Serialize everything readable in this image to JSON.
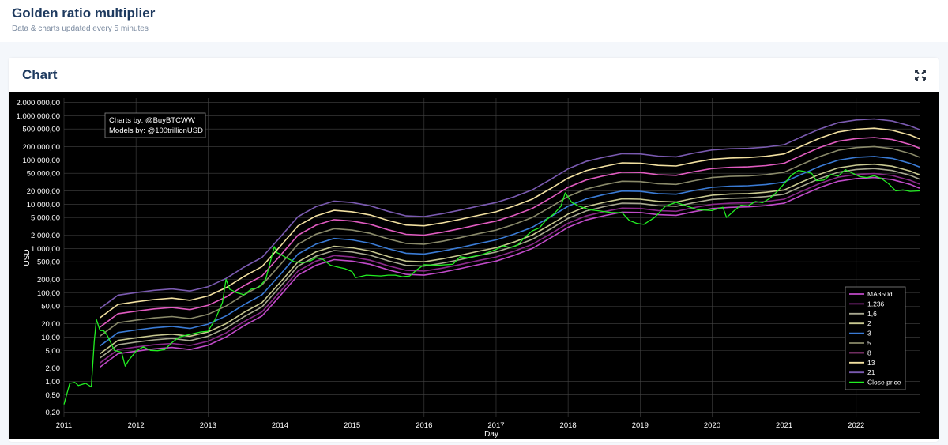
{
  "header": {
    "title": "Golden ratio multiplier",
    "subtitle": "Data & charts updated every 5 minutes"
  },
  "card": {
    "title": "Chart"
  },
  "colors": {
    "title": "#1e3a5f",
    "chart_bg": "#000000",
    "grid": "#444444"
  },
  "credits": {
    "line1": "Charts by: @BuyBTCWW",
    "line2": "Models by: @100trillionUSD"
  },
  "chart_data": {
    "type": "line",
    "xlabel": "Day",
    "ylabel": "USD",
    "yscale": "log",
    "ylim": [
      0.16,
      2500000
    ],
    "xlim": [
      2011.0,
      2022.88
    ],
    "grid": true,
    "legend_position": "bottom-right",
    "x_ticks": [
      "2011",
      "2012",
      "2013",
      "2014",
      "2015",
      "2016",
      "2017",
      "2018",
      "2019",
      "2020",
      "2021",
      "2022"
    ],
    "y_ticks": [
      {
        "value": 0.2,
        "label": "0,20"
      },
      {
        "value": 0.5,
        "label": "0,50"
      },
      {
        "value": 1,
        "label": "1,00"
      },
      {
        "value": 2,
        "label": "2,00"
      },
      {
        "value": 5,
        "label": "5,00"
      },
      {
        "value": 10,
        "label": "10,00"
      },
      {
        "value": 20,
        "label": "20,00"
      },
      {
        "value": 50,
        "label": "50,00"
      },
      {
        "value": 100,
        "label": "100,00"
      },
      {
        "value": 200,
        "label": "200,00"
      },
      {
        "value": 500,
        "label": "500,00"
      },
      {
        "value": 1000,
        "label": "1.000,00"
      },
      {
        "value": 2000,
        "label": "2.000,00"
      },
      {
        "value": 5000,
        "label": "5.000,00"
      },
      {
        "value": 10000,
        "label": "10.000,00"
      },
      {
        "value": 20000,
        "label": "20.000,00"
      },
      {
        "value": 50000,
        "label": "50.000,00"
      },
      {
        "value": 100000,
        "label": "100.000,00"
      },
      {
        "value": 200000,
        "label": "200.000,00"
      },
      {
        "value": 500000,
        "label": "500.000,00"
      },
      {
        "value": 1000000,
        "label": "1.000.000,00"
      },
      {
        "value": 2000000,
        "label": "2.000.000,00"
      }
    ],
    "ma350": {
      "x": [
        2011.5,
        2011.75,
        2012.0,
        2012.25,
        2012.5,
        2012.75,
        2013.0,
        2013.25,
        2013.5,
        2013.75,
        2014.0,
        2014.25,
        2014.5,
        2014.75,
        2015.0,
        2015.25,
        2015.5,
        2015.75,
        2016.0,
        2016.25,
        2016.5,
        2016.75,
        2017.0,
        2017.25,
        2017.5,
        2017.75,
        2018.0,
        2018.25,
        2018.5,
        2018.75,
        2019.0,
        2019.25,
        2019.5,
        2019.75,
        2020.0,
        2020.25,
        2020.5,
        2020.75,
        2021.0,
        2021.25,
        2021.5,
        2021.75,
        2022.0,
        2022.25,
        2022.5,
        2022.75,
        2022.88
      ],
      "y": [
        2.1,
        4.2,
        4.8,
        5.4,
        5.8,
        5.2,
        6.5,
        10,
        18,
        30,
        85,
        250,
        420,
        560,
        520,
        440,
        330,
        260,
        250,
        290,
        350,
        430,
        520,
        700,
        1000,
        1700,
        3000,
        4400,
        5500,
        6600,
        6500,
        5800,
        5600,
        6800,
        8000,
        8500,
        8700,
        9300,
        10500,
        16000,
        24000,
        33000,
        38000,
        40000,
        36000,
        28000,
        23000
      ]
    },
    "series": [
      {
        "name": "MA350d",
        "multiplier": 1,
        "color": "#c04ac8"
      },
      {
        "name": "1,236",
        "multiplier": 1.236,
        "color": "#8a2a8a"
      },
      {
        "name": "1,6",
        "multiplier": 1.6,
        "color": "#a8a890"
      },
      {
        "name": "2",
        "multiplier": 2,
        "color": "#c8c890"
      },
      {
        "name": "3",
        "multiplier": 3,
        "color": "#3a7bd5"
      },
      {
        "name": "5",
        "multiplier": 5,
        "color": "#8a8a6a"
      },
      {
        "name": "8",
        "multiplier": 8,
        "color": "#e05bc0"
      },
      {
        "name": "13",
        "multiplier": 13,
        "color": "#f2e0a0"
      },
      {
        "name": "21",
        "multiplier": 21,
        "color": "#7a5ab0"
      }
    ],
    "close_price": {
      "name": "Close price",
      "color": "#22ee22",
      "x": [
        2011.0,
        2011.08,
        2011.15,
        2011.2,
        2011.3,
        2011.38,
        2011.42,
        2011.45,
        2011.5,
        2011.55,
        2011.6,
        2011.7,
        2011.8,
        2011.85,
        2011.9,
        2012.0,
        2012.1,
        2012.2,
        2012.3,
        2012.4,
        2012.5,
        2012.6,
        2012.7,
        2012.8,
        2012.9,
        2013.0,
        2013.1,
        2013.2,
        2013.25,
        2013.3,
        2013.35,
        2013.4,
        2013.5,
        2013.6,
        2013.7,
        2013.8,
        2013.85,
        2013.92,
        2013.96,
        2014.0,
        2014.1,
        2014.2,
        2014.3,
        2014.4,
        2014.5,
        2014.6,
        2014.7,
        2014.8,
        2014.9,
        2015.0,
        2015.05,
        2015.2,
        2015.4,
        2015.5,
        2015.6,
        2015.7,
        2015.8,
        2015.9,
        2016.0,
        2016.2,
        2016.4,
        2016.5,
        2016.6,
        2016.8,
        2017.0,
        2017.1,
        2017.2,
        2017.3,
        2017.4,
        2017.5,
        2017.6,
        2017.7,
        2017.8,
        2017.9,
        2017.96,
        2018.05,
        2018.15,
        2018.3,
        2018.45,
        2018.6,
        2018.75,
        2018.85,
        2018.95,
        2019.05,
        2019.2,
        2019.35,
        2019.5,
        2019.65,
        2019.8,
        2020.0,
        2020.15,
        2020.2,
        2020.3,
        2020.4,
        2020.5,
        2020.6,
        2020.7,
        2020.8,
        2020.9,
        2021.0,
        2021.1,
        2021.2,
        2021.28,
        2021.38,
        2021.45,
        2021.55,
        2021.65,
        2021.75,
        2021.85,
        2021.95,
        2022.05,
        2022.15,
        2022.25,
        2022.35,
        2022.45,
        2022.55,
        2022.65,
        2022.75,
        2022.88
      ],
      "y": [
        0.3,
        0.9,
        0.95,
        0.8,
        0.9,
        0.75,
        8,
        25,
        14,
        14,
        11,
        5,
        4.5,
        2.2,
        3,
        4.8,
        6,
        5,
        4.9,
        5.2,
        7.5,
        10,
        11,
        12,
        13,
        13.5,
        25,
        60,
        200,
        120,
        110,
        100,
        90,
        120,
        130,
        200,
        400,
        1100,
        800,
        750,
        600,
        500,
        480,
        500,
        620,
        560,
        420,
        380,
        350,
        300,
        220,
        250,
        240,
        250,
        250,
        230,
        240,
        330,
        430,
        420,
        440,
        650,
        620,
        720,
        950,
        1150,
        1050,
        1200,
        1800,
        2500,
        2900,
        4500,
        6000,
        9000,
        18000,
        11000,
        9000,
        7500,
        7000,
        6500,
        6400,
        4300,
        3700,
        3500,
        5000,
        9000,
        11000,
        9000,
        7500,
        7200,
        8500,
        5000,
        7000,
        9500,
        9200,
        11500,
        10800,
        13500,
        19000,
        29000,
        45000,
        58000,
        55000,
        50000,
        34000,
        35000,
        47000,
        43000,
        60000,
        50000,
        42000,
        40000,
        44000,
        38000,
        29000,
        20000,
        21000,
        19500,
        20000
      ]
    }
  }
}
